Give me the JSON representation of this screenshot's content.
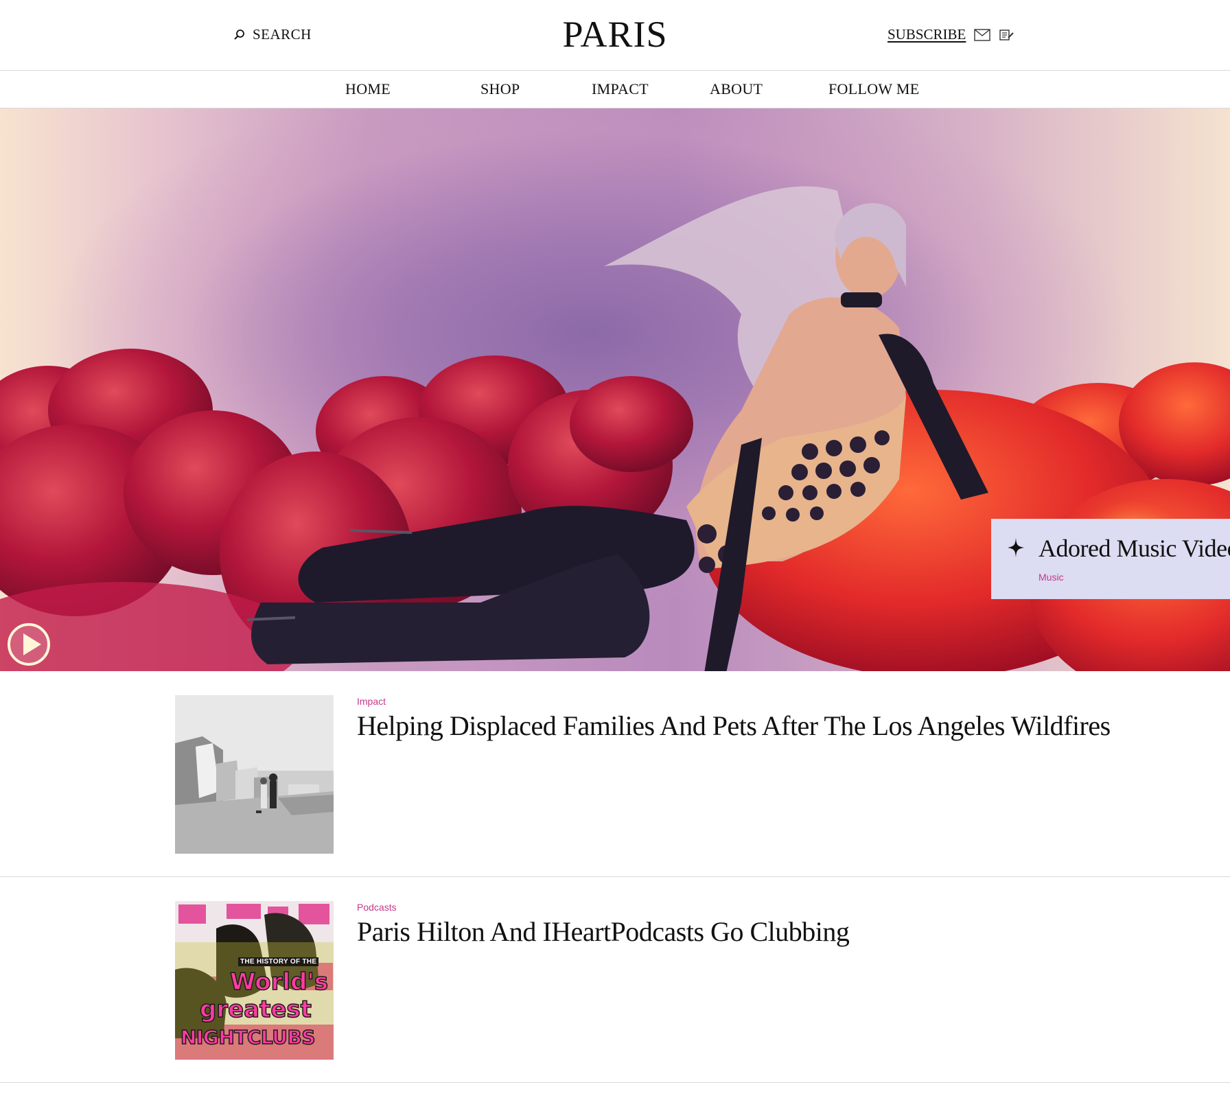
{
  "header": {
    "search_label": "SEARCH",
    "logo": "PARIS",
    "subscribe_label": "SUBSCRIBE"
  },
  "nav": {
    "items": [
      {
        "label": "HOME"
      },
      {
        "label": "SHOP"
      },
      {
        "label": "IMPACT"
      },
      {
        "label": "ABOUT"
      },
      {
        "label": "FOLLOW ME"
      }
    ]
  },
  "hero": {
    "feature": {
      "title": "Adored Music Video",
      "category": "Music"
    }
  },
  "articles": [
    {
      "category": "Impact",
      "headline": "Helping Displaced Families And Pets After The Los Angeles Wildfires"
    },
    {
      "category": "Podcasts",
      "headline": "Paris Hilton And IHeartPodcasts Go Clubbing",
      "thumb_text": {
        "line1": "THE HISTORY OF THE",
        "line2": "World's",
        "line3": "greatest",
        "line4": "NIGHTCLUBS"
      }
    }
  ],
  "colors": {
    "accent": "#c5378a",
    "feature_card_bg": "#dcdcf2",
    "divider": "#d8d8d8"
  }
}
